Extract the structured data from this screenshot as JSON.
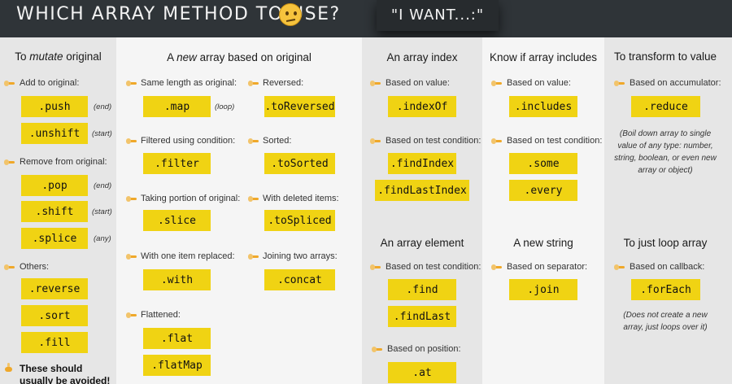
{
  "header": {
    "title": "WHICH ARRAY METHOD TO USE?",
    "title_emoji": "thinking-face-icon",
    "want": "\"I WANT...:\""
  },
  "colors": {
    "pill": "#f0d313",
    "header_bg": "#2f3438",
    "col_dark": "#e6e6e6",
    "col_light": "#f5f5f5"
  },
  "col1": {
    "title_prefix": "To ",
    "title_em": "mutate",
    "title_suffix": " original",
    "add": "Add to original:",
    "push": ".push",
    "push_note": "(end)",
    "unshift": ".unshift",
    "unshift_note": "(start)",
    "remove": "Remove from original:",
    "pop": ".pop",
    "pop_note": "(end)",
    "shift": ".shift",
    "shift_note": "(start)",
    "splice": ".splice",
    "splice_note": "(any)",
    "others": "Others:",
    "reverse": ".reverse",
    "sort": ".sort",
    "fill": ".fill",
    "warning": "These should usually be avoided!"
  },
  "col2": {
    "title_prefix": "A ",
    "title_em": "new",
    "title_suffix": " array based on original",
    "same": "Same length as original:",
    "map": ".map",
    "map_note": "(loop)",
    "filtered": "Filtered using condition:",
    "filter": ".filter",
    "portion": "Taking portion of original:",
    "slice": ".slice",
    "replaced": "With one item replaced:",
    "with": ".with",
    "flattened": "Flattened:",
    "flat": ".flat",
    "flatMap": ".flatMap",
    "reversed": "Reversed:",
    "toReversed": ".toReversed",
    "sorted": "Sorted:",
    "toSorted": ".toSorted",
    "deleted": "With deleted items:",
    "toSpliced": ".toSpliced",
    "joining": "Joining two arrays:",
    "concat": ".concat"
  },
  "col3": {
    "title": "An array index",
    "value": "Based on value:",
    "indexOf": ".indexOf",
    "test": "Based on test condition:",
    "findIndex": ".findIndex",
    "findLastIndex": ".findLastIndex",
    "title2": "An array element",
    "test2": "Based on test condition:",
    "find": ".find",
    "findLast": ".findLast",
    "position": "Based on position:",
    "at": ".at"
  },
  "col4": {
    "title": "Know if array includes",
    "value": "Based on value:",
    "includes": ".includes",
    "test": "Based on test condition:",
    "some": ".some",
    "every": ".every",
    "title2": "A new string",
    "separator": "Based on separator:",
    "join": ".join"
  },
  "col5": {
    "title": "To transform to value",
    "accumulator": "Based on accumulator:",
    "reduce": ".reduce",
    "reduce_note": "(Boil down array to single value of any type: number, string, boolean, or even new array or object)",
    "title2": "To just loop array",
    "callback": "Based on callback:",
    "forEach": ".forEach",
    "forEach_note": "(Does not create a new array, just loops over it)"
  }
}
